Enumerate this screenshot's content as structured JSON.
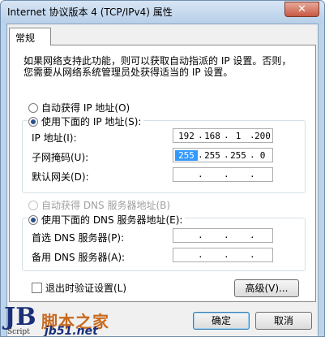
{
  "window": {
    "title": "Internet 协议版本 4 (TCP/IPv4) 属性",
    "close_label": "✕"
  },
  "tab": {
    "label": "常规"
  },
  "intro": {
    "line1": "如果网络支持此功能，则可以获取自动指派的 IP 设置。否则，",
    "line2": "您需要从网络系统管理员处获得适当的 IP 设置。"
  },
  "ip_section": {
    "auto_label": "自动获得 IP 地址(O)",
    "manual_label": "使用下面的 IP 地址(S):",
    "selected": "manual",
    "fields": [
      {
        "label": "IP 地址(I):",
        "octets": [
          "192",
          "168",
          "1",
          "200"
        ]
      },
      {
        "label": "子网掩码(U):",
        "octets": [
          "255",
          "255",
          "255",
          "0"
        ]
      },
      {
        "label": "默认网关(D):",
        "octets": [
          "",
          "",
          "",
          ""
        ]
      }
    ]
  },
  "dns_section": {
    "auto_label": "自动获得 DNS 服务器地址(B)",
    "manual_label": "使用下面的 DNS 服务器地址(E):",
    "selected": "manual",
    "fields": [
      {
        "label": "首选 DNS 服务器(P):",
        "octets": [
          "",
          "",
          "",
          ""
        ]
      },
      {
        "label": "备用 DNS 服务器(A):",
        "octets": [
          "",
          "",
          "",
          ""
        ]
      }
    ]
  },
  "validate_label": "退出时验证设置(L)",
  "advanced_label": "高级(V)...",
  "ok_label": "确定",
  "cancel_label": "取消",
  "watermark": {
    "logo": "JB",
    "script": "Script",
    "cn": "脚本之家",
    "url": "jb51.net"
  }
}
